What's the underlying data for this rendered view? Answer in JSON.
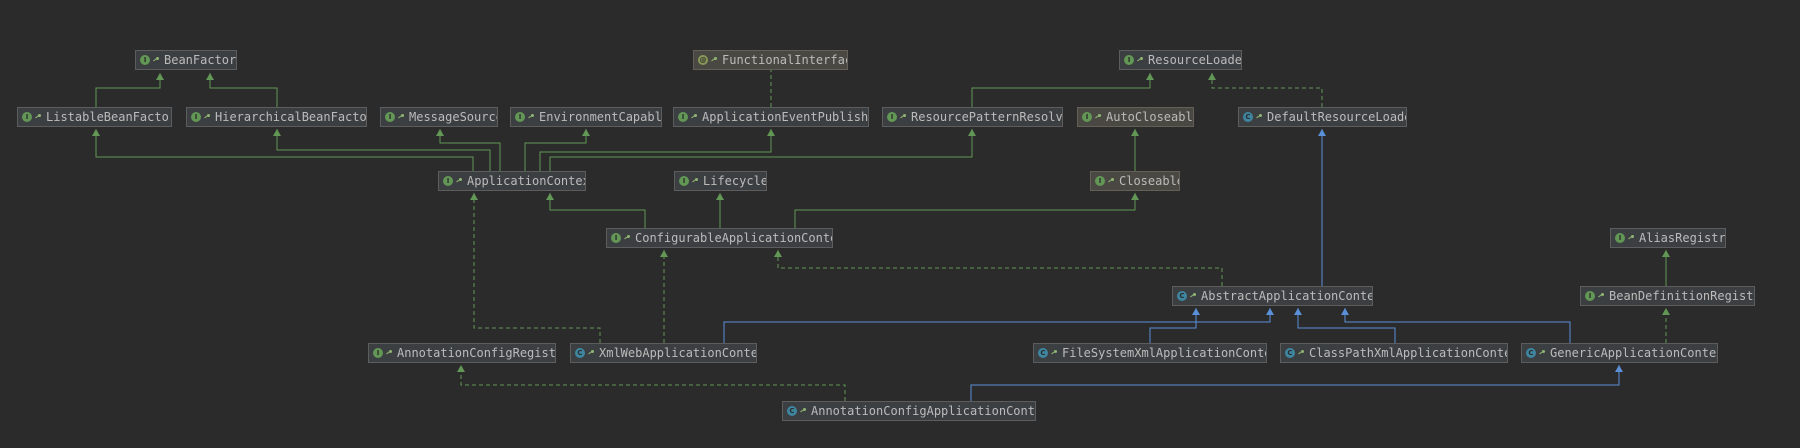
{
  "nodes": [
    {
      "id": "beanfactory",
      "label": "BeanFactory",
      "kind": "interface"
    },
    {
      "id": "listable",
      "label": "ListableBeanFactor",
      "kind": "interface"
    },
    {
      "id": "hierarchical",
      "label": "HierarchicalBeanFactor",
      "kind": "interface"
    },
    {
      "id": "messagesource",
      "label": "MessageSource",
      "kind": "interface"
    },
    {
      "id": "environment",
      "label": "EnvironmentCapable",
      "kind": "interface"
    },
    {
      "id": "functional",
      "label": "FunctionalInterfac",
      "kind": "annotation"
    },
    {
      "id": "eventpublisher",
      "label": "ApplicationEventPublishe",
      "kind": "interface"
    },
    {
      "id": "resourceloader",
      "label": "ResourceLoader",
      "kind": "interface"
    },
    {
      "id": "patternresolver",
      "label": "ResourcePatternResolve",
      "kind": "interface"
    },
    {
      "id": "autocloseable",
      "label": "AutoCloseable",
      "kind": "interface-ext"
    },
    {
      "id": "defaultresourceloader",
      "label": "DefaultResourceLoade",
      "kind": "class"
    },
    {
      "id": "appcontext",
      "label": "ApplicationContext",
      "kind": "interface"
    },
    {
      "id": "lifecycle",
      "label": "Lifecycle",
      "kind": "interface"
    },
    {
      "id": "closeable",
      "label": "Closeable",
      "kind": "interface-ext"
    },
    {
      "id": "configurable",
      "label": "ConfigurableApplicationContex",
      "kind": "interface"
    },
    {
      "id": "aliasregistry",
      "label": "AliasRegistry",
      "kind": "interface"
    },
    {
      "id": "abstractctx",
      "label": "AbstractApplicationContex",
      "kind": "abstract"
    },
    {
      "id": "beandefregistry",
      "label": "BeanDefinitionRegistr",
      "kind": "interface"
    },
    {
      "id": "annotationregistry",
      "label": "AnnotationConfigRegistr",
      "kind": "interface"
    },
    {
      "id": "xmlweb",
      "label": "XmlWebApplicationContex",
      "kind": "class"
    },
    {
      "id": "filesystem",
      "label": "FileSystemXmlApplicationContex",
      "kind": "class"
    },
    {
      "id": "classpath",
      "label": "ClassPathXmlApplicationContex",
      "kind": "class"
    },
    {
      "id": "generic",
      "label": "GenericApplicationContex",
      "kind": "class"
    },
    {
      "id": "annotationctx",
      "label": "AnnotationConfigApplicationConte",
      "kind": "class"
    }
  ],
  "colors": {
    "background": "#2b2b2b",
    "interface_edge": "#629755",
    "class_edge": "#5b8fd8",
    "node_bg": "#3c3f41",
    "node_border": "#5d5d5d",
    "text": "#bbbbbb"
  },
  "icons": {
    "interface": "interface-icon",
    "class": "class-icon",
    "annotation": "annotation-icon",
    "pin": "pin-icon"
  }
}
